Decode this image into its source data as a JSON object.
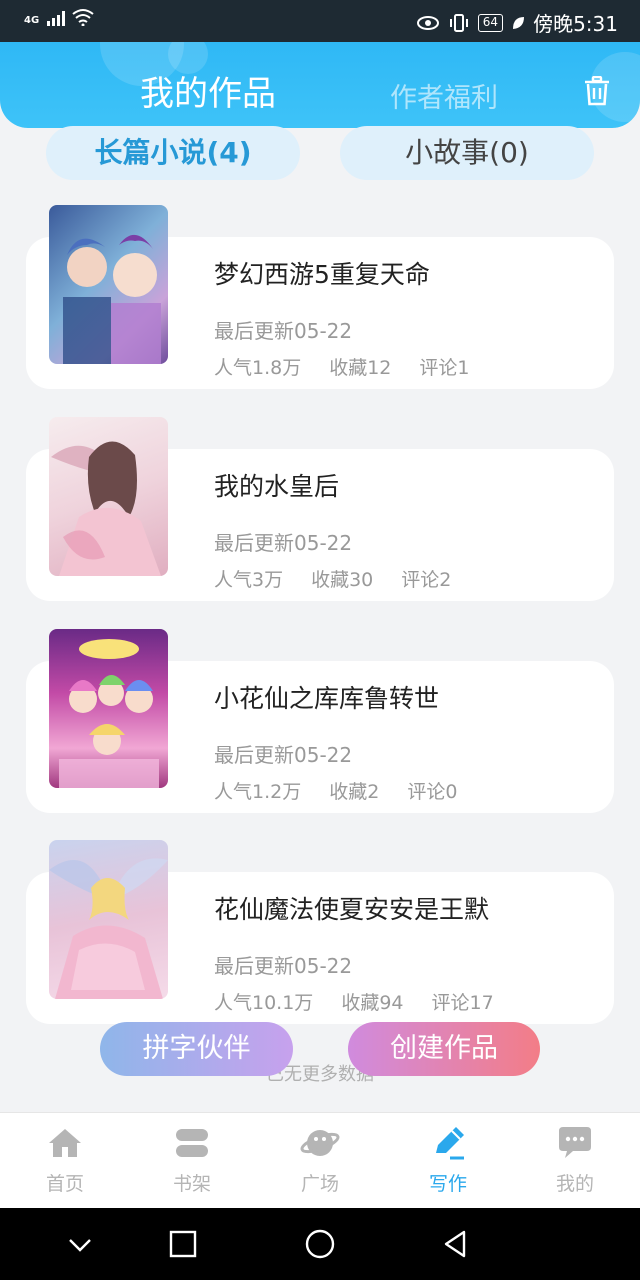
{
  "status_bar": {
    "network": "4G",
    "battery": "64",
    "time_text": "傍晚5:31"
  },
  "header": {
    "tab_active": "我的作品",
    "tab_inactive": "作者福利"
  },
  "subtabs": {
    "novels": "长篇小说(4)",
    "stories": "小故事(0)"
  },
  "works": [
    {
      "title": "梦幻西游5重复天命",
      "updated": "最后更新05-22",
      "popularity": "人气1.8万",
      "favorites": "收藏12",
      "comments": "评论1",
      "cover_colors": [
        "#3a5a9a",
        "#7fb0d8",
        "#c9a3d9"
      ]
    },
    {
      "title": "我的水皇后",
      "updated": "最后更新05-22",
      "popularity": "人气3万",
      "favorites": "收藏30",
      "comments": "评论2",
      "cover_colors": [
        "#f3e3e6",
        "#d9a6b8",
        "#efd3dc"
      ]
    },
    {
      "title": "小花仙之库库鲁转世",
      "updated": "最后更新05-22",
      "popularity": "人气1.2万",
      "favorites": "收藏2",
      "comments": "评论0",
      "cover_colors": [
        "#7a2b8f",
        "#d45db1",
        "#f7c8e3"
      ]
    },
    {
      "title": "花仙魔法使夏安安是王默",
      "updated": "最后更新05-22",
      "popularity": "人气10.1万",
      "favorites": "收藏94",
      "comments": "评论17",
      "cover_colors": [
        "#cfd7ef",
        "#e8c3d8",
        "#f5dbe9"
      ]
    }
  ],
  "buttons": {
    "partner": "拼字伙伴",
    "create": "创建作品"
  },
  "loaded_text": "已无更多数据",
  "bottom_nav": [
    {
      "label": "首页",
      "icon": "home-icon"
    },
    {
      "label": "书架",
      "icon": "bookshelf-icon"
    },
    {
      "label": "广场",
      "icon": "planet-icon"
    },
    {
      "label": "写作",
      "icon": "pen-icon"
    },
    {
      "label": "我的",
      "icon": "chat-bubble-icon"
    }
  ],
  "colors": {
    "primary": "#2fb8f5",
    "active_nav": "#2aa8ec",
    "inactive_nav": "#b5b5b5"
  }
}
